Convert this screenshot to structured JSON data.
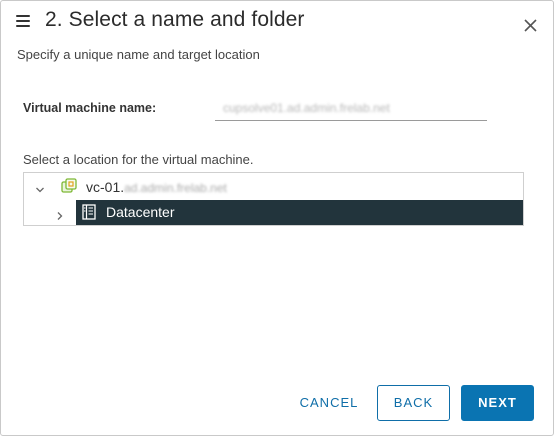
{
  "dialog": {
    "title": "2. Select a name and folder",
    "subtitle": "Specify a unique name and target location"
  },
  "form": {
    "vm_name_label": "Virtual machine name:",
    "vm_name_value": "cupsolve01.ad.admin.frelab.net",
    "location_label": "Select a location for the virtual machine."
  },
  "tree": {
    "vcenter": {
      "prefix": "vc-01.",
      "hostname_blurred": "ad.admin.frelab.net",
      "icon": "vcenter-icon"
    },
    "datacenter": {
      "label": "Datacenter",
      "icon": "datacenter-icon",
      "selected": true
    }
  },
  "buttons": {
    "cancel": "CANCEL",
    "back": "BACK",
    "next": "NEXT"
  },
  "colors": {
    "accent": "#0a74b2",
    "selected_row": "#22343c",
    "vcenter_icon": "#8cc63f"
  }
}
